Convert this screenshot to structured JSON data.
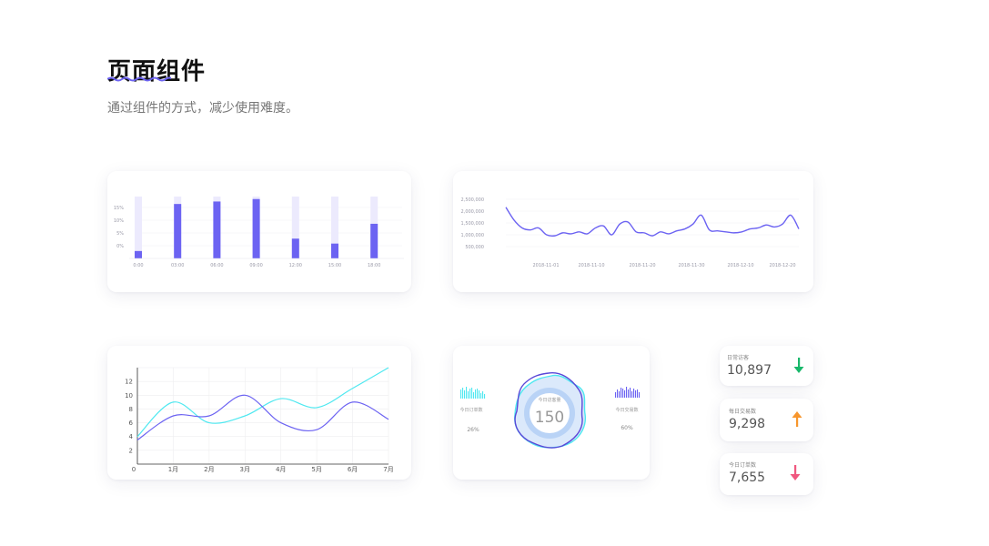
{
  "header": {
    "title": "页面组件",
    "subtitle": "通过组件的方式，减少使用难度。"
  },
  "colors": {
    "accent": "#6c63f2",
    "cyan": "#4fe8f0",
    "green": "#19b86b",
    "orange": "#f7962d",
    "pink": "#f0587f"
  },
  "chart_data": [
    {
      "type": "bar",
      "categories": [
        "0:00",
        "03:00",
        "06:00",
        "09:00",
        "12:00",
        "15:00",
        "18:00"
      ],
      "values": [
        3,
        22,
        23,
        24,
        8,
        6,
        14
      ],
      "ylim": [
        0,
        25
      ],
      "yticks": [
        "0%",
        "5%",
        "10%",
        "15%"
      ]
    },
    {
      "type": "line",
      "yticks": [
        "500,000",
        "1,000,000",
        "1,500,000",
        "2,000,000",
        "2,500,000"
      ],
      "xticks": [
        "2018-11-01",
        "2018-11-10",
        "2018-11-20",
        "2018-11-30",
        "2018-12-10",
        "2018-12-20"
      ],
      "values": [
        2.0,
        1.35,
        0.95,
        0.85,
        0.95,
        0.6,
        0.55,
        0.7,
        0.65,
        0.75,
        0.65,
        0.95,
        1.05,
        0.6,
        1.15,
        1.25,
        0.75,
        0.7,
        0.55,
        0.75,
        0.65,
        0.8,
        0.9,
        1.15,
        1.6,
        0.85,
        0.8,
        0.75,
        0.7,
        0.75,
        0.9,
        0.95,
        1.1,
        1.0,
        1.15,
        1.6,
        0.9
      ],
      "ylim": [
        0,
        2.5
      ]
    },
    {
      "type": "line",
      "categories": [
        "0",
        "1月",
        "2月",
        "3月",
        "4月",
        "5月",
        "6月",
        "7月"
      ],
      "yticks": [
        "2",
        "4",
        "6",
        "8",
        "10",
        "12"
      ],
      "ylim": [
        0,
        14
      ],
      "series": [
        {
          "values": [
            4,
            9,
            6,
            7,
            9.5,
            8.2,
            11,
            14
          ],
          "color": "cyan"
        },
        {
          "values": [
            3.5,
            7,
            7,
            10,
            6,
            5,
            9,
            6.5
          ],
          "color": "accent"
        }
      ]
    }
  ],
  "gauge": {
    "label": "今日访客量",
    "value": "150",
    "left_label": "今日订单数",
    "left_percent": "26%",
    "right_label": "今日交易数",
    "right_percent": "60%"
  },
  "kpis": [
    {
      "label": "日常访客",
      "value": "10,897",
      "trend": "down",
      "color": "#19b86b"
    },
    {
      "label": "每日交易数",
      "value": "9,298",
      "trend": "up",
      "color": "#f7962d"
    },
    {
      "label": "今日订单数",
      "value": "7,655",
      "trend": "down",
      "color": "#f0587f"
    }
  ]
}
